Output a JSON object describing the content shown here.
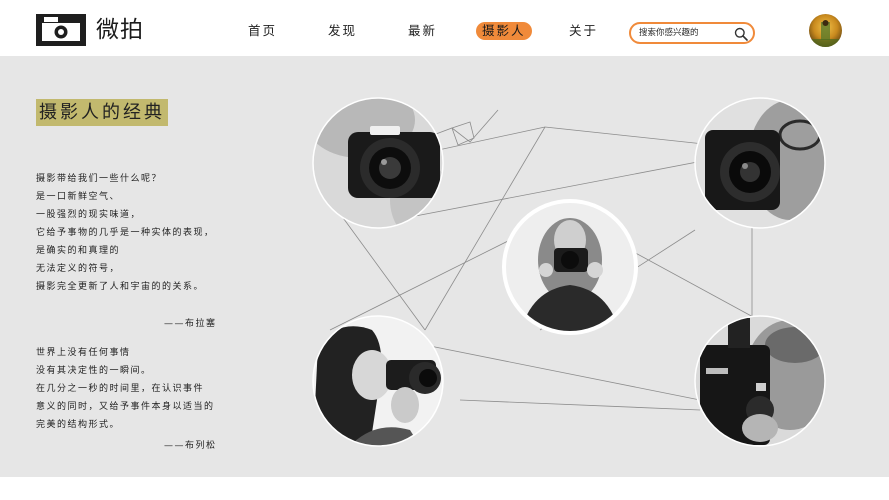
{
  "brand": {
    "name": "微拍"
  },
  "nav": {
    "items": [
      {
        "label": "首页",
        "active": false
      },
      {
        "label": "发现",
        "active": false
      },
      {
        "label": "最新",
        "active": false
      },
      {
        "label": "摄影人",
        "active": true
      },
      {
        "label": "关于",
        "active": false
      }
    ]
  },
  "search": {
    "placeholder": "搜索你感兴趣的",
    "value": ""
  },
  "colors": {
    "accent": "#f08a3a",
    "title_highlight": "#c2b96e",
    "background": "#e6e6e6"
  },
  "section": {
    "title": "摄影人的经典"
  },
  "quotes": [
    {
      "lines": [
        "摄影带给我们一些什么呢？",
        "是一口新鲜空气、",
        "一股强烈的现实味道，",
        "它给予事物的几乎是一种实体的表现，",
        "是确实的和真理的",
        "无法定义的符号，",
        "摄影完全更新了人和宇宙的的关系。"
      ],
      "author": "——布拉塞"
    },
    {
      "lines": [
        "世界上没有任何事情",
        "没有其决定性的一瞬间。",
        "在几分之一秒的时间里，在认识事件",
        "意义的同时，又给予事件本身以适当的",
        "完美的结构形式。"
      ],
      "author": "——布列松"
    }
  ],
  "photos": [
    {
      "icon": "photographer-photo-1"
    },
    {
      "icon": "photographer-photo-2"
    },
    {
      "icon": "photographer-photo-3"
    },
    {
      "icon": "photographer-photo-4"
    },
    {
      "icon": "photographer-photo-5"
    }
  ]
}
